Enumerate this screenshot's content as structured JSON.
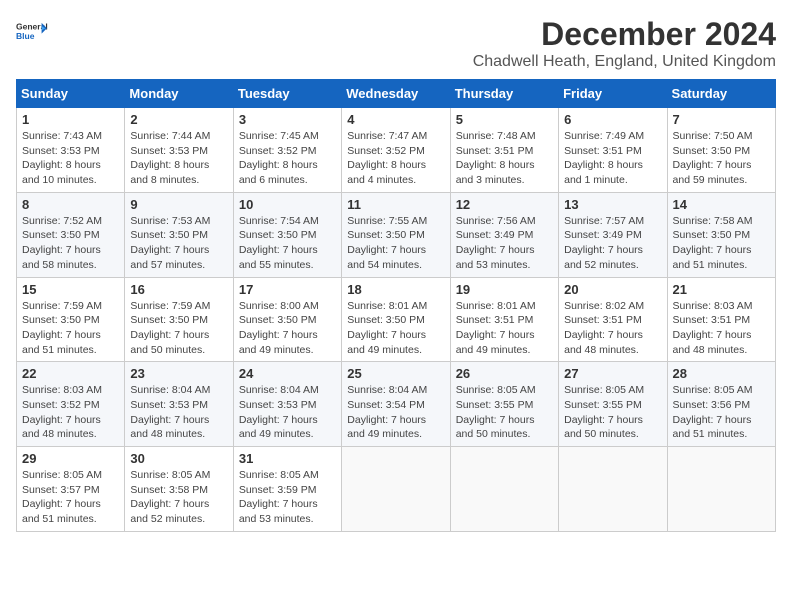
{
  "logo": {
    "general": "General",
    "blue": "Blue"
  },
  "title": "December 2024",
  "location": "Chadwell Heath, England, United Kingdom",
  "headers": [
    "Sunday",
    "Monday",
    "Tuesday",
    "Wednesday",
    "Thursday",
    "Friday",
    "Saturday"
  ],
  "weeks": [
    [
      {
        "day": "1",
        "details": "Sunrise: 7:43 AM\nSunset: 3:53 PM\nDaylight: 8 hours\nand 10 minutes."
      },
      {
        "day": "2",
        "details": "Sunrise: 7:44 AM\nSunset: 3:53 PM\nDaylight: 8 hours\nand 8 minutes."
      },
      {
        "day": "3",
        "details": "Sunrise: 7:45 AM\nSunset: 3:52 PM\nDaylight: 8 hours\nand 6 minutes."
      },
      {
        "day": "4",
        "details": "Sunrise: 7:47 AM\nSunset: 3:52 PM\nDaylight: 8 hours\nand 4 minutes."
      },
      {
        "day": "5",
        "details": "Sunrise: 7:48 AM\nSunset: 3:51 PM\nDaylight: 8 hours\nand 3 minutes."
      },
      {
        "day": "6",
        "details": "Sunrise: 7:49 AM\nSunset: 3:51 PM\nDaylight: 8 hours\nand 1 minute."
      },
      {
        "day": "7",
        "details": "Sunrise: 7:50 AM\nSunset: 3:50 PM\nDaylight: 7 hours\nand 59 minutes."
      }
    ],
    [
      {
        "day": "8",
        "details": "Sunrise: 7:52 AM\nSunset: 3:50 PM\nDaylight: 7 hours\nand 58 minutes."
      },
      {
        "day": "9",
        "details": "Sunrise: 7:53 AM\nSunset: 3:50 PM\nDaylight: 7 hours\nand 57 minutes."
      },
      {
        "day": "10",
        "details": "Sunrise: 7:54 AM\nSunset: 3:50 PM\nDaylight: 7 hours\nand 55 minutes."
      },
      {
        "day": "11",
        "details": "Sunrise: 7:55 AM\nSunset: 3:50 PM\nDaylight: 7 hours\nand 54 minutes."
      },
      {
        "day": "12",
        "details": "Sunrise: 7:56 AM\nSunset: 3:49 PM\nDaylight: 7 hours\nand 53 minutes."
      },
      {
        "day": "13",
        "details": "Sunrise: 7:57 AM\nSunset: 3:49 PM\nDaylight: 7 hours\nand 52 minutes."
      },
      {
        "day": "14",
        "details": "Sunrise: 7:58 AM\nSunset: 3:50 PM\nDaylight: 7 hours\nand 51 minutes."
      }
    ],
    [
      {
        "day": "15",
        "details": "Sunrise: 7:59 AM\nSunset: 3:50 PM\nDaylight: 7 hours\nand 51 minutes."
      },
      {
        "day": "16",
        "details": "Sunrise: 7:59 AM\nSunset: 3:50 PM\nDaylight: 7 hours\nand 50 minutes."
      },
      {
        "day": "17",
        "details": "Sunrise: 8:00 AM\nSunset: 3:50 PM\nDaylight: 7 hours\nand 49 minutes."
      },
      {
        "day": "18",
        "details": "Sunrise: 8:01 AM\nSunset: 3:50 PM\nDaylight: 7 hours\nand 49 minutes."
      },
      {
        "day": "19",
        "details": "Sunrise: 8:01 AM\nSunset: 3:51 PM\nDaylight: 7 hours\nand 49 minutes."
      },
      {
        "day": "20",
        "details": "Sunrise: 8:02 AM\nSunset: 3:51 PM\nDaylight: 7 hours\nand 48 minutes."
      },
      {
        "day": "21",
        "details": "Sunrise: 8:03 AM\nSunset: 3:51 PM\nDaylight: 7 hours\nand 48 minutes."
      }
    ],
    [
      {
        "day": "22",
        "details": "Sunrise: 8:03 AM\nSunset: 3:52 PM\nDaylight: 7 hours\nand 48 minutes."
      },
      {
        "day": "23",
        "details": "Sunrise: 8:04 AM\nSunset: 3:53 PM\nDaylight: 7 hours\nand 48 minutes."
      },
      {
        "day": "24",
        "details": "Sunrise: 8:04 AM\nSunset: 3:53 PM\nDaylight: 7 hours\nand 49 minutes."
      },
      {
        "day": "25",
        "details": "Sunrise: 8:04 AM\nSunset: 3:54 PM\nDaylight: 7 hours\nand 49 minutes."
      },
      {
        "day": "26",
        "details": "Sunrise: 8:05 AM\nSunset: 3:55 PM\nDaylight: 7 hours\nand 50 minutes."
      },
      {
        "day": "27",
        "details": "Sunrise: 8:05 AM\nSunset: 3:55 PM\nDaylight: 7 hours\nand 50 minutes."
      },
      {
        "day": "28",
        "details": "Sunrise: 8:05 AM\nSunset: 3:56 PM\nDaylight: 7 hours\nand 51 minutes."
      }
    ],
    [
      {
        "day": "29",
        "details": "Sunrise: 8:05 AM\nSunset: 3:57 PM\nDaylight: 7 hours\nand 51 minutes."
      },
      {
        "day": "30",
        "details": "Sunrise: 8:05 AM\nSunset: 3:58 PM\nDaylight: 7 hours\nand 52 minutes."
      },
      {
        "day": "31",
        "details": "Sunrise: 8:05 AM\nSunset: 3:59 PM\nDaylight: 7 hours\nand 53 minutes."
      },
      null,
      null,
      null,
      null
    ]
  ]
}
